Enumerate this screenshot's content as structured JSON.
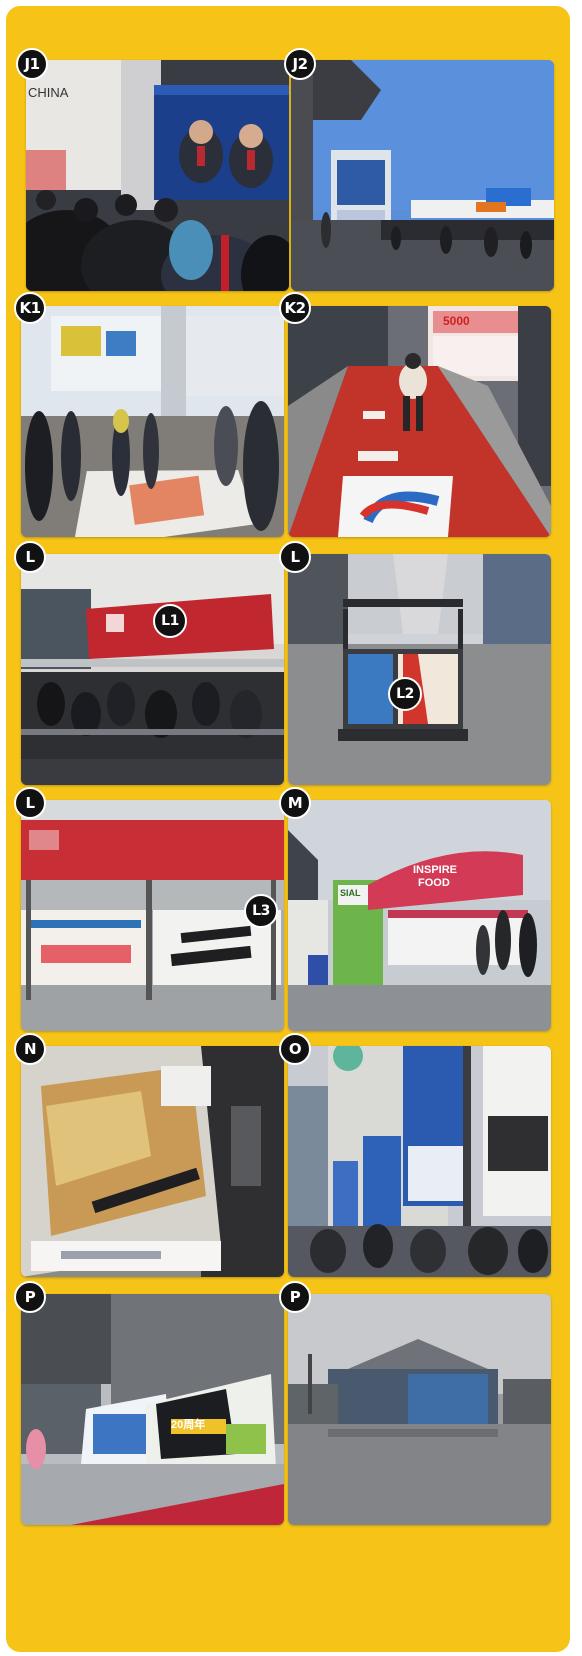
{
  "photos": [
    {
      "label": "J1",
      "j1_text": "CHINA"
    },
    {
      "label": "J2"
    },
    {
      "label": "K1"
    },
    {
      "label": "K2",
      "k2_text": "5000"
    },
    {
      "label": "L",
      "inner": "L1"
    },
    {
      "label": "L",
      "inner": "L2"
    },
    {
      "label": "L",
      "inner": "L3"
    },
    {
      "label": "M",
      "m_sign": "SIAL",
      "m_banner1": "INSPIRE",
      "m_banner2": "FOOD"
    },
    {
      "label": "N"
    },
    {
      "label": "O"
    },
    {
      "label": "P",
      "p_sign": "20周年"
    },
    {
      "label": "P"
    }
  ],
  "colors": {
    "panel": "#f6c416",
    "badge": "#111111",
    "badge_border": "#ffffff"
  }
}
